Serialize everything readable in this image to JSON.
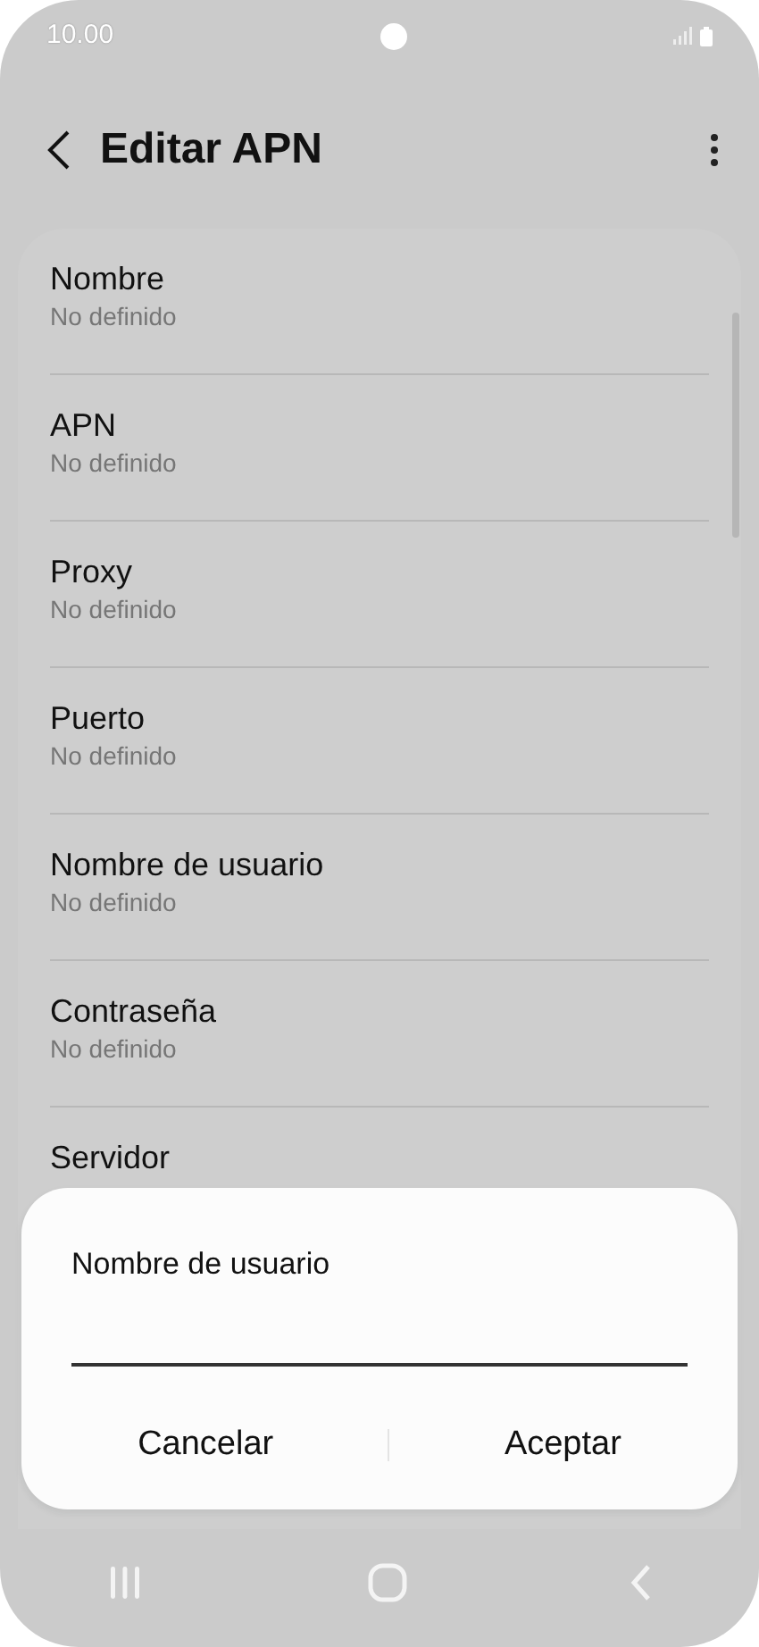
{
  "status_bar": {
    "time": "10.00"
  },
  "header": {
    "title": "Editar APN"
  },
  "settings": [
    {
      "title": "Nombre",
      "value": "No definido"
    },
    {
      "title": "APN",
      "value": "No definido"
    },
    {
      "title": "Proxy",
      "value": "No definido"
    },
    {
      "title": "Puerto",
      "value": "No definido"
    },
    {
      "title": "Nombre de usuario",
      "value": "No definido"
    },
    {
      "title": "Contraseña",
      "value": "No definido"
    },
    {
      "title": "Servidor"
    }
  ],
  "dialog": {
    "title": "Nombre de usuario",
    "buttons": [
      "Cancelar",
      "Aceptar"
    ]
  }
}
